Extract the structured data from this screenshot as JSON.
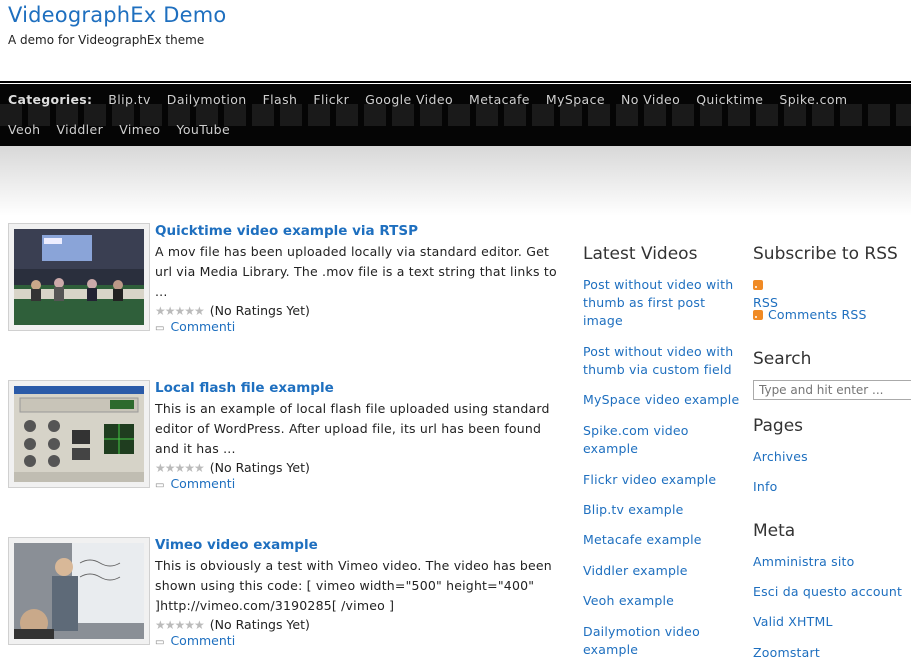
{
  "site": {
    "title": "VideographEx Demo",
    "description": "A demo for VideographEx theme"
  },
  "categories": {
    "label": "Categories:",
    "items": [
      "Blip.tv",
      "Dailymotion",
      "Flash",
      "Flickr",
      "Google Video",
      "Metacafe",
      "MySpace",
      "No Video",
      "Quicktime",
      "Spike.com",
      "Veoh",
      "Viddler",
      "Vimeo",
      "YouTube"
    ]
  },
  "posts": [
    {
      "title": "Quicktime video example via RTSP",
      "excerpt": "A mov file has been uploaded locally via standard editor. Get url via Media Library. The .mov file is a text string that links to ...",
      "rating": "(No Ratings Yet)",
      "comments": "Commenti"
    },
    {
      "title": "Local flash file example",
      "excerpt": "This is an example of local flash file uploaded using standard editor of WordPress. After upload file, its url has been found and it has ...",
      "rating": "(No Ratings Yet)",
      "comments": "Commenti"
    },
    {
      "title": "Vimeo video example",
      "excerpt": "This is obviously a test with Vimeo video. The video has been shown using this code: [ vimeo width=\"500\" height=\"400\" ]http://vimeo.com/3190285[ /vimeo ]",
      "rating": "(No Ratings Yet)",
      "comments": "Commenti"
    }
  ],
  "latest_videos": {
    "heading": "Latest Videos",
    "items": [
      "Post without video with thumb as first post image",
      "Post without video with thumb via custom field",
      "MySpace video example",
      "Spike.com video example",
      "Flickr video example",
      "Blip.tv example",
      "Metacafe example",
      "Viddler example",
      "Veoh example",
      "Dailymotion video example"
    ]
  },
  "subscribe": {
    "heading": "Subscribe to RSS",
    "items": [
      "RSS",
      "Comments RSS"
    ]
  },
  "search": {
    "heading": "Search",
    "placeholder": "Type and hit enter ..."
  },
  "pages": {
    "heading": "Pages",
    "items": [
      "Archives",
      "Info"
    ]
  },
  "meta": {
    "heading": "Meta",
    "items": [
      "Amministra sito",
      "Esci da questo account",
      "Valid XHTML",
      "Zoomstart"
    ]
  },
  "colors": {
    "link": "#1e6fbf",
    "nav_bg": "#050505",
    "rss": "#f08a24"
  },
  "icons": {
    "rss": "rss-feed-icon",
    "comment": "comment-bubble-icon",
    "rating": "rating-stars-icon"
  }
}
